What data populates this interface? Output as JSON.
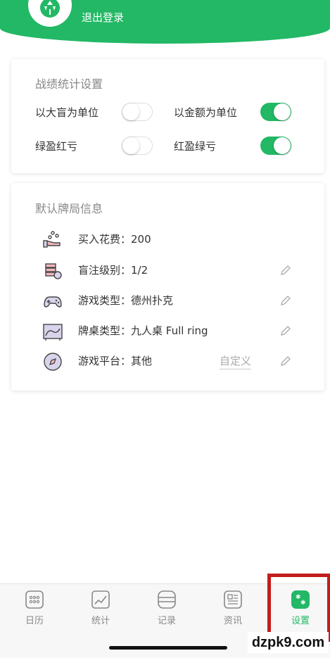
{
  "header": {
    "logout_label": "退出登录"
  },
  "stats_settings": {
    "title": "战绩统计设置",
    "toggles": [
      {
        "label": "以大盲为单位",
        "on": false
      },
      {
        "label": "以金额为单位",
        "on": true
      },
      {
        "label": "绿盈红亏",
        "on": false
      },
      {
        "label": "红盈绿亏",
        "on": true
      }
    ]
  },
  "default_game": {
    "title": "默认牌局信息",
    "rows": [
      {
        "label": "买入花费：200",
        "icon": "hand-coins-icon",
        "editable": false
      },
      {
        "label": "盲注级别：1/2",
        "icon": "chips-stack-icon",
        "editable": true
      },
      {
        "label": "游戏类型：德州扑克",
        "icon": "gamepad-icon",
        "editable": true
      },
      {
        "label": "牌桌类型：九人桌 Full ring",
        "icon": "poker-table-icon",
        "editable": true
      },
      {
        "label": "游戏平台：其他",
        "icon": "compass-icon",
        "editable": true,
        "custom_label": "自定义"
      }
    ]
  },
  "tabbar": {
    "tabs": [
      {
        "label": "日历",
        "icon": "calendar-grid-icon",
        "active": false
      },
      {
        "label": "统计",
        "icon": "line-chart-icon",
        "active": false
      },
      {
        "label": "记录",
        "icon": "record-list-icon",
        "active": false
      },
      {
        "label": "资讯",
        "icon": "news-icon",
        "active": false
      },
      {
        "label": "设置",
        "icon": "settings-icon",
        "active": true
      }
    ]
  },
  "watermark": "dzpk9.com",
  "colors": {
    "accent": "#22b865",
    "highlight_box": "#c21d1d"
  }
}
